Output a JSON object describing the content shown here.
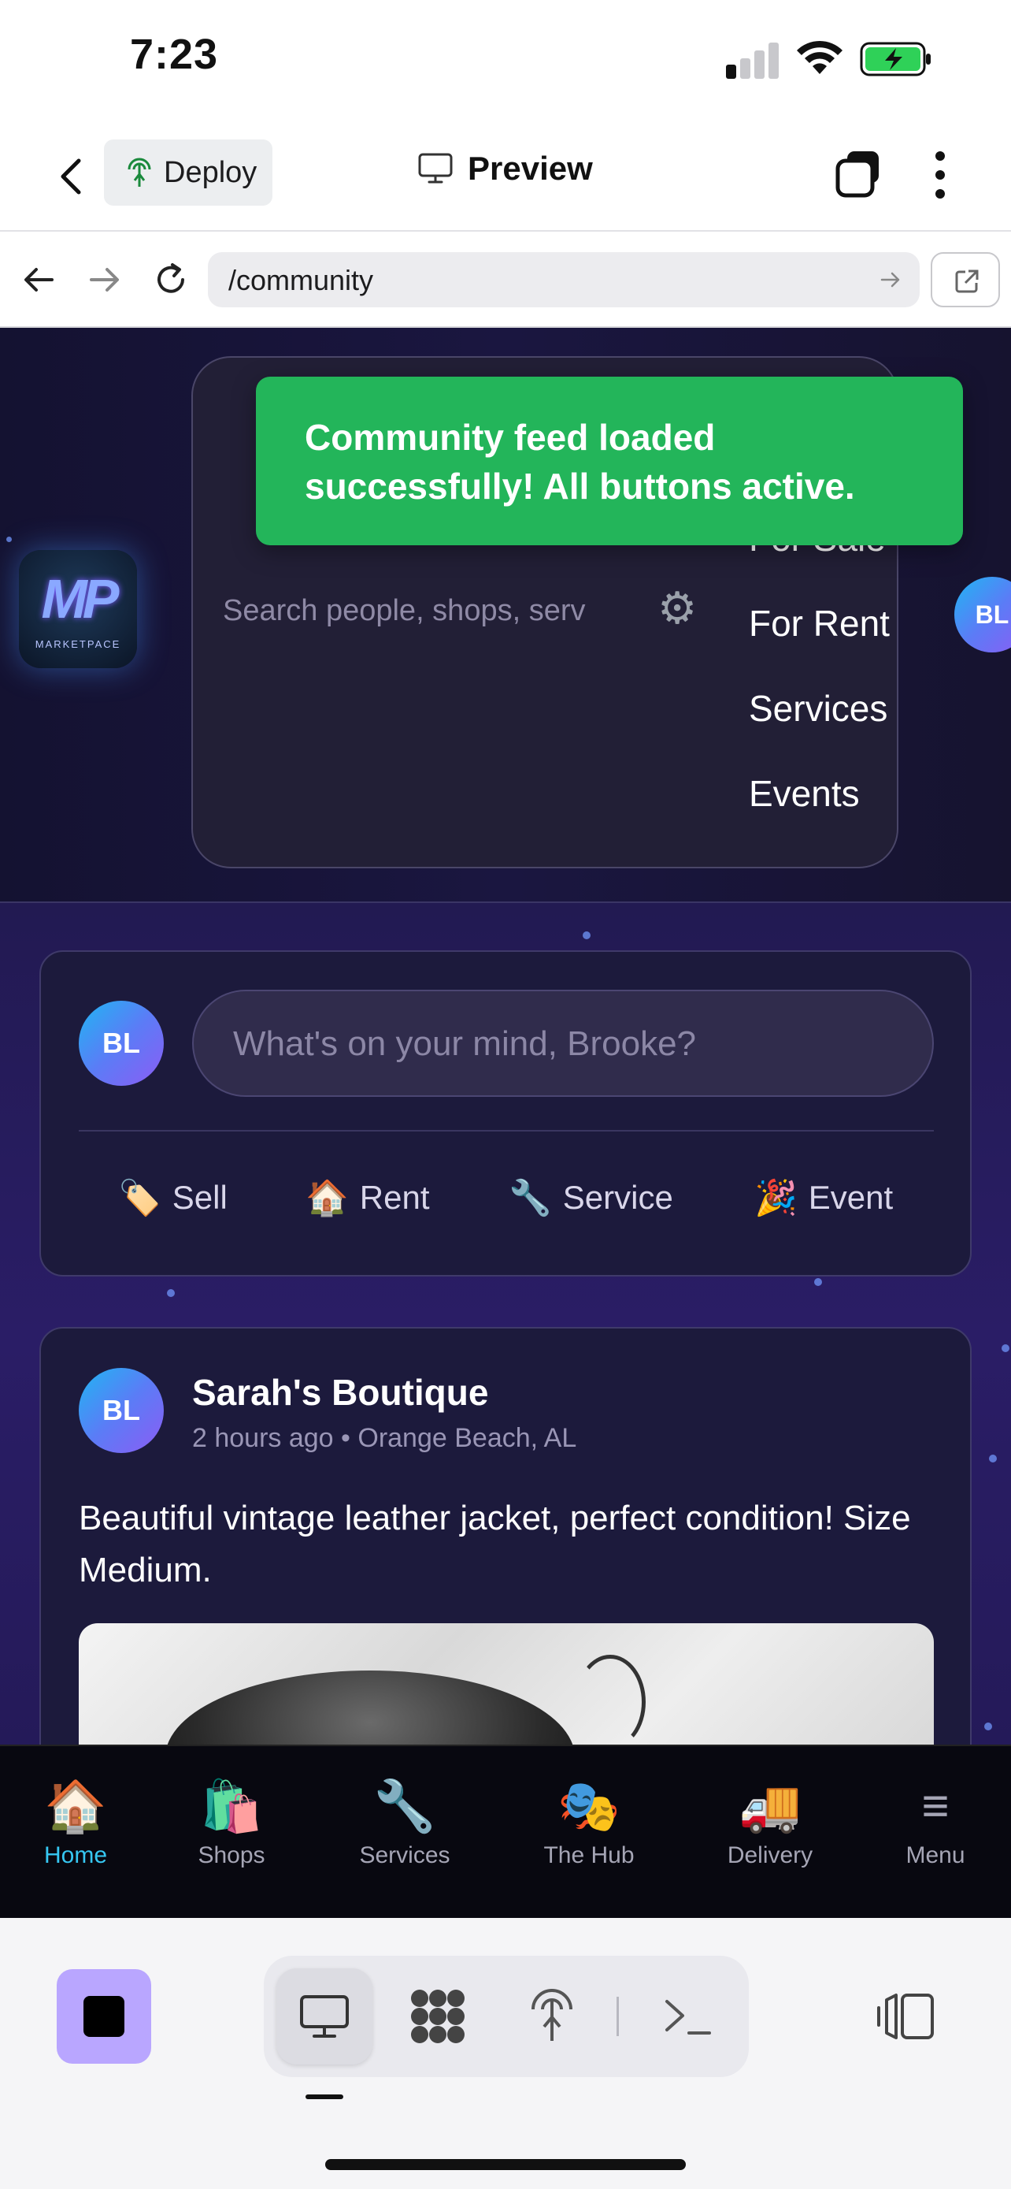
{
  "status_bar": {
    "time": "7:23"
  },
  "app_header": {
    "deploy_label": "Deploy",
    "preview_label": "Preview"
  },
  "browser": {
    "url": "/community"
  },
  "site": {
    "logo_text": "MP",
    "logo_tagline": "MARKETPACE",
    "search_placeholder": "Search people, shops, serv",
    "filters": [
      "For Sale",
      "For Rent",
      "Services",
      "Events"
    ],
    "profile_initials": "BL"
  },
  "toast": {
    "message": "Community feed loaded successfully! All buttons active."
  },
  "composer": {
    "avatar_initials": "BL",
    "placeholder": "What's on your mind, Brooke?",
    "actions": [
      {
        "icon": "🏷️",
        "label": "Sell"
      },
      {
        "icon": "🏠",
        "label": "Rent"
      },
      {
        "icon": "🔧",
        "label": "Service"
      },
      {
        "icon": "🎉",
        "label": "Event"
      }
    ]
  },
  "post": {
    "avatar_initials": "BL",
    "author": "Sarah's Boutique",
    "meta": "2 hours ago • Orange Beach, AL",
    "text": "Beautiful vintage leather jacket, perfect condition! Size Medium."
  },
  "bottom_nav": [
    {
      "icon": "🏠",
      "label": "Home",
      "active": true
    },
    {
      "icon": "🛍️",
      "label": "Shops",
      "active": false
    },
    {
      "icon": "🔧",
      "label": "Services",
      "active": false
    },
    {
      "icon": "🎭",
      "label": "The Hub",
      "active": false
    },
    {
      "icon": "🚚",
      "label": "Delivery",
      "active": false
    },
    {
      "icon": "≡",
      "label": "Menu",
      "active": false
    }
  ],
  "colors": {
    "toast_bg": "#23b55a",
    "nav_active": "#36c7f2",
    "stop_button": "#b9a6ff"
  }
}
